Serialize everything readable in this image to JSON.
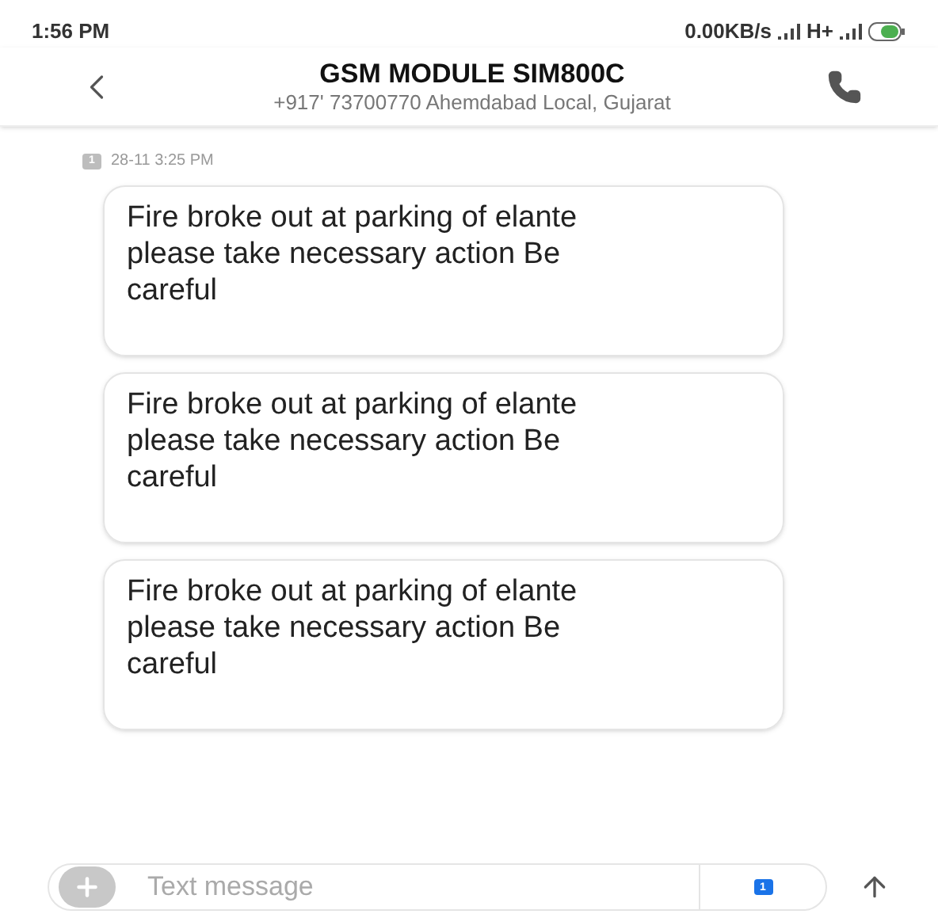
{
  "status_bar": {
    "time": "1:56 PM",
    "network": "0.00KB/s",
    "net_type": "H+"
  },
  "header": {
    "title": "GSM MODULE SIM800C",
    "subtitle": "+917' 73700770 Ahemdabad Local, Gujarat"
  },
  "timestamp": {
    "sim": "1",
    "text": "28-11 3:25 PM"
  },
  "messages": [
    {
      "text": "Fire broke out at parking of elante please take necessary action Be careful"
    },
    {
      "text": "Fire broke out at parking of elante please take necessary action Be careful"
    },
    {
      "text": "Fire broke out at parking of elante please take necessary action Be careful"
    }
  ],
  "composer": {
    "placeholder": "Text message",
    "sim": "1"
  }
}
